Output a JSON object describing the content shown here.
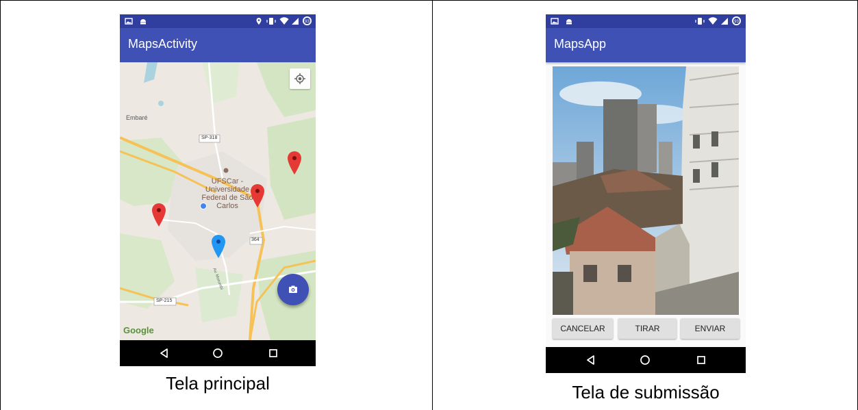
{
  "left_screen": {
    "app_title": "MapsActivity",
    "caption": "Tela principal",
    "map": {
      "places": [
        "Embaré",
        "UFSCar - Universidade Federal de São Carlos"
      ],
      "roads": [
        "SP-318",
        "SP-215",
        "364",
        "Av. Morumbi"
      ],
      "attribution": "Google"
    },
    "battery_text": "93"
  },
  "right_screen": {
    "app_title": "MapsApp",
    "caption": "Tela de submissão",
    "buttons": {
      "cancel": "CANCELAR",
      "take": "TIRAR",
      "send": "ENVIAR"
    },
    "battery_text": "93"
  },
  "colors": {
    "primary": "#3F51B5",
    "fab": "#3F51B5",
    "pin_red": "#E53935",
    "pin_blue": "#2196F3"
  },
  "icons": [
    "image-icon",
    "android-icon",
    "location-icon",
    "vibrate-icon",
    "wifi-icon",
    "signal-icon",
    "battery-icon",
    "my-location-icon",
    "camera-icon",
    "back-icon",
    "home-icon",
    "recents-icon"
  ]
}
